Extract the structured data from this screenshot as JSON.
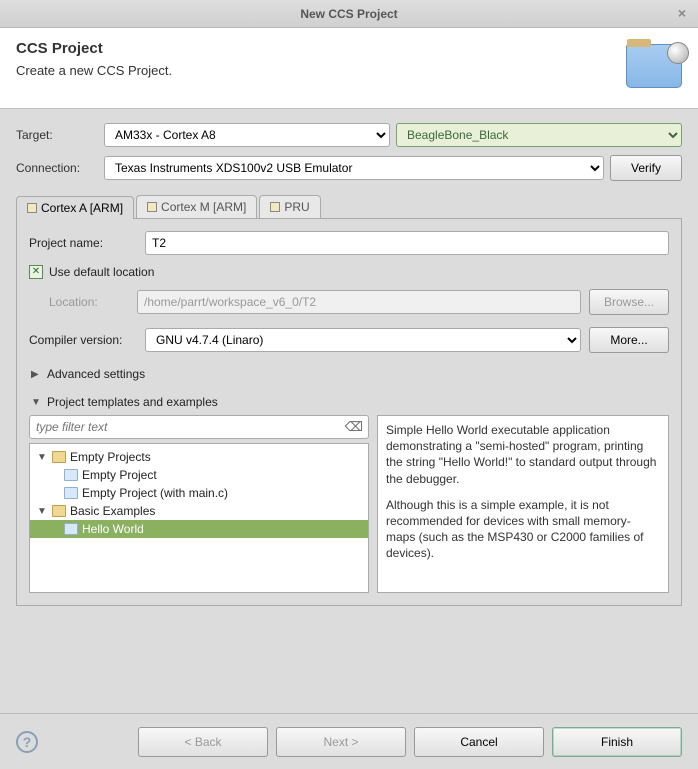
{
  "window": {
    "title": "New CCS Project"
  },
  "header": {
    "title": "CCS Project",
    "subtitle": "Create a new CCS Project."
  },
  "target": {
    "label": "Target:",
    "family": "AM33x - Cortex A8",
    "device": "BeagleBone_Black"
  },
  "connection": {
    "label": "Connection:",
    "value": "Texas Instruments XDS100v2 USB Emulator",
    "verify_label": "Verify"
  },
  "tabs": {
    "items": [
      {
        "label": "Cortex A [ARM]",
        "active": true
      },
      {
        "label": "Cortex M [ARM]",
        "active": false
      },
      {
        "label": "PRU",
        "active": false
      }
    ]
  },
  "project": {
    "name_label": "Project name:",
    "name_value": "T2",
    "use_default_label": "Use default location",
    "use_default_checked": true,
    "location_label": "Location:",
    "location_value": "/home/parrt/workspace_v6_0/T2",
    "browse_label": "Browse..."
  },
  "compiler": {
    "label": "Compiler version:",
    "value": "GNU v4.7.4 (Linaro)",
    "more_label": "More..."
  },
  "sections": {
    "advanced": "Advanced settings",
    "templates": "Project templates and examples"
  },
  "filter": {
    "placeholder": "type filter text"
  },
  "tree": {
    "nodes": [
      {
        "label": "Empty Projects",
        "type": "category",
        "expanded": true
      },
      {
        "label": "Empty Project",
        "type": "item"
      },
      {
        "label": "Empty Project (with main.c)",
        "type": "item"
      },
      {
        "label": "Basic Examples",
        "type": "category",
        "expanded": true
      },
      {
        "label": "Hello World",
        "type": "item",
        "selected": true
      }
    ]
  },
  "description": {
    "p1": "Simple Hello World executable application demonstrating a \"semi-hosted\" program, printing the string \"Hello World!\" to standard output through the debugger.",
    "p2": "Although this is a simple example, it is not recommended for devices with small memory-maps (such as the MSP430 or C2000 families of devices)."
  },
  "footer": {
    "back": "< Back",
    "next": "Next >",
    "cancel": "Cancel",
    "finish": "Finish"
  }
}
